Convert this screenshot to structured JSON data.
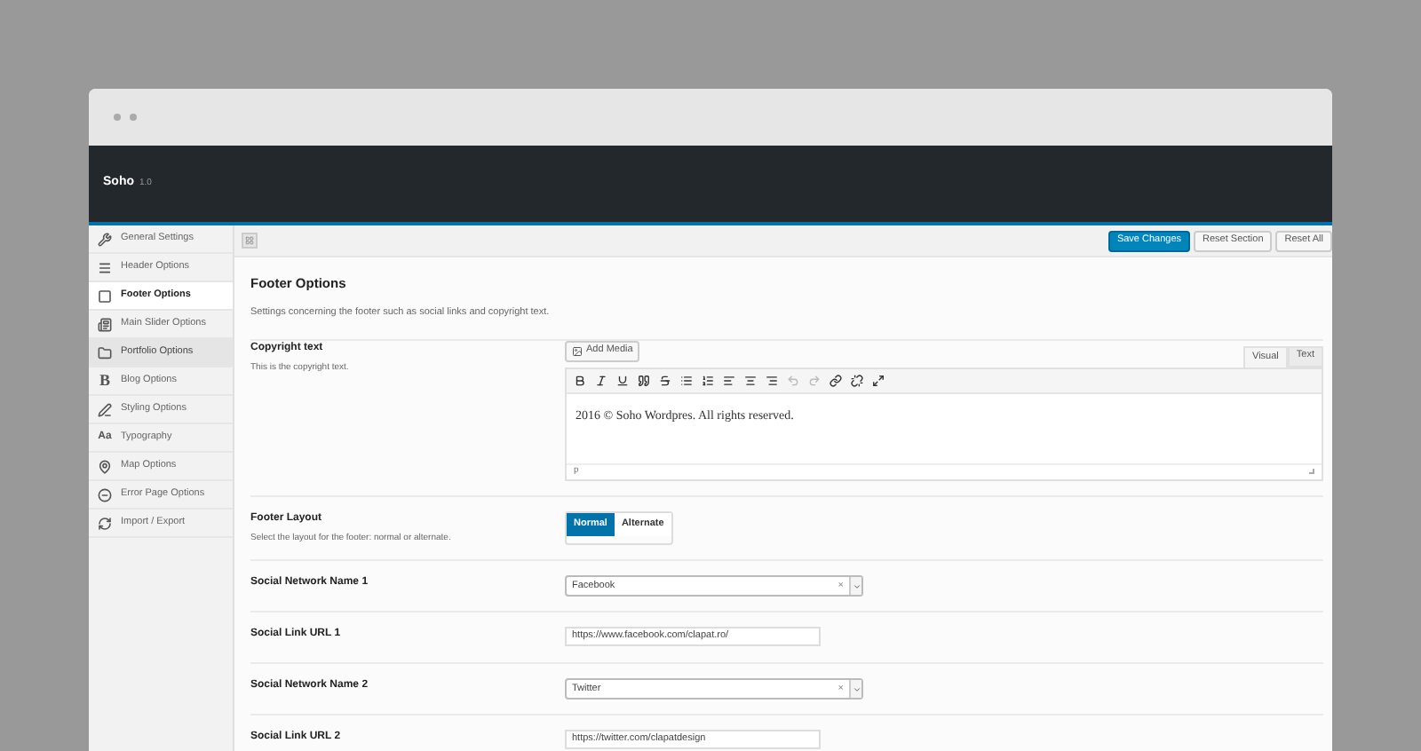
{
  "header": {
    "title": "Soho",
    "version": "1.0"
  },
  "sidebar": {
    "items": [
      {
        "label": "General Settings",
        "selected": false,
        "highlighted": false
      },
      {
        "label": "Header Options",
        "selected": false,
        "highlighted": false
      },
      {
        "label": "Footer Options",
        "selected": true,
        "highlighted": false
      },
      {
        "label": "Main Slider Options",
        "selected": false,
        "highlighted": false
      },
      {
        "label": "Portfolio Options",
        "selected": false,
        "highlighted": true
      },
      {
        "label": "Blog Options",
        "selected": false,
        "highlighted": false,
        "icon_text": "B"
      },
      {
        "label": "Styling Options",
        "selected": false,
        "highlighted": false
      },
      {
        "label": "Typography",
        "selected": false,
        "highlighted": false,
        "icon_text": "Aa"
      },
      {
        "label": "Map Options",
        "selected": false,
        "highlighted": false
      },
      {
        "label": "Error Page Options",
        "selected": false,
        "highlighted": false
      },
      {
        "label": "Import / Export",
        "selected": false,
        "highlighted": false
      }
    ]
  },
  "toolbar": {
    "buttons": [
      {
        "label": "Save Changes",
        "kind": "primary"
      },
      {
        "label": "Reset Section",
        "kind": "secondary"
      },
      {
        "label": "Reset All",
        "kind": "secondary"
      }
    ]
  },
  "section": {
    "title": "Footer Options",
    "description": "Settings concerning the footer such as social links and copyright text."
  },
  "rows": [
    {
      "kind": "editor",
      "label": "Copyright text",
      "description": "This is the copyright text.",
      "add_media": "Add Media",
      "tabs": [
        {
          "label": "Visual",
          "selected": true
        },
        {
          "label": "Text",
          "selected": false
        }
      ],
      "content": "2016 © Soho Wordpres. All rights reserved.",
      "path": "p"
    },
    {
      "kind": "buttonset",
      "label": "Footer Layout",
      "description": "Select the layout for the footer: normal or alternate.",
      "options": [
        {
          "label": "Normal",
          "selected": true
        },
        {
          "label": "Alternate",
          "selected": false
        }
      ]
    },
    {
      "kind": "select",
      "label": "Social Network Name 1",
      "value": "Facebook",
      "clear": "×"
    },
    {
      "kind": "text",
      "label": "Social Link URL 1",
      "value": "https://www.facebook.com/clapat.ro/"
    },
    {
      "kind": "select",
      "label": "Social Network Name 2",
      "value": "Twitter",
      "clear": "×"
    },
    {
      "kind": "text",
      "label": "Social Link URL 2",
      "value": "https://twitter.com/clapatdesign"
    }
  ]
}
